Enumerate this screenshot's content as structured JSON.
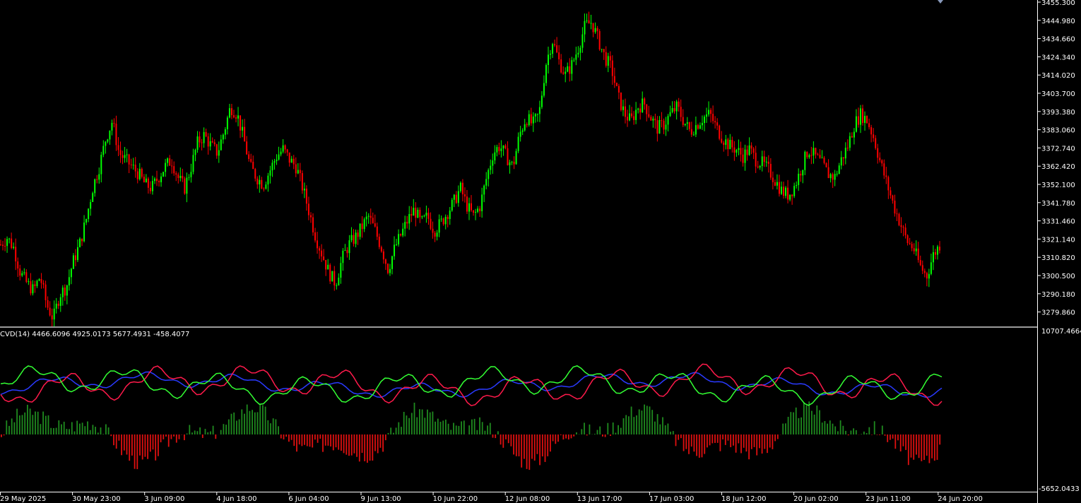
{
  "symbol_chart": {
    "price_axis_labels": [
      "3455.300",
      "3444.980",
      "3434.660",
      "3424.340",
      "3414.020",
      "3403.700",
      "3393.380",
      "3383.060",
      "3372.740",
      "3362.420",
      "3352.100",
      "3341.780",
      "3331.460",
      "3321.140",
      "3310.820",
      "3300.500",
      "3290.180",
      "3279.860"
    ],
    "time_axis_labels": [
      "29 May 2025",
      "30 May 23:00",
      "3 Jun 09:00",
      "4 Jun 18:00",
      "6 Jun 04:00",
      "9 Jun 13:00",
      "10 Jun 22:00",
      "12 Jun 08:00",
      "13 Jun 17:00",
      "17 Jun 03:00",
      "18 Jun 12:00",
      "20 Jun 02:00",
      "23 Jun 11:00",
      "24 Jun 20:00"
    ],
    "colors": {
      "bull": "#00ff00",
      "bear": "#ff0000",
      "background": "#000000",
      "axis": "#ffffff",
      "separator": "#808080"
    }
  },
  "indicator": {
    "title": "CVD(14) 4466.6096 4925.0173 5677.4931 -458.4077",
    "scale_max_label": "10707.4664",
    "scale_min_label": "-5652.0433",
    "colors": {
      "line_red": "#ff1a4b",
      "line_green": "#33ff33",
      "line_blue": "#2a3aff",
      "hist_pos": "#1f8a1f",
      "hist_neg": "#e01010"
    }
  },
  "chart_data": {
    "type": "candlestick",
    "price_range": [
      3274.7,
      3455.3
    ],
    "candles_close_path": [
      3318,
      3322,
      3316,
      3302,
      3296,
      3292,
      3300,
      3284,
      3276,
      3290,
      3294,
      3308,
      3318,
      3332,
      3350,
      3362,
      3378,
      3388,
      3370,
      3366,
      3362,
      3358,
      3352,
      3350,
      3356,
      3362,
      3366,
      3356,
      3350,
      3362,
      3376,
      3380,
      3374,
      3370,
      3382,
      3396,
      3392,
      3378,
      3362,
      3356,
      3352,
      3360,
      3368,
      3372,
      3366,
      3362,
      3350,
      3336,
      3322,
      3312,
      3302,
      3296,
      3310,
      3318,
      3322,
      3328,
      3334,
      3326,
      3316,
      3304,
      3316,
      3324,
      3332,
      3338,
      3330,
      3334,
      3326,
      3330,
      3336,
      3342,
      3350,
      3340,
      3334,
      3340,
      3356,
      3370,
      3374,
      3368,
      3362,
      3380,
      3390,
      3386,
      3392,
      3420,
      3434,
      3422,
      3414,
      3420,
      3430,
      3442,
      3444,
      3434,
      3424,
      3418,
      3402,
      3392,
      3388,
      3396,
      3398,
      3390,
      3384,
      3386,
      3392,
      3396,
      3388,
      3382,
      3386,
      3390,
      3392,
      3384,
      3378,
      3374,
      3372,
      3368,
      3372,
      3366,
      3364,
      3360,
      3354,
      3348,
      3346,
      3352,
      3362,
      3372,
      3368,
      3364,
      3358,
      3356,
      3366,
      3374,
      3386,
      3392,
      3388,
      3378,
      3364,
      3352,
      3340,
      3330,
      3320,
      3316,
      3306,
      3300,
      3312,
      3318
    ],
    "indicator": {
      "name": "CVD(14)",
      "values_shown": [
        4466.6096,
        4925.0173,
        5677.4931,
        -458.4077
      ],
      "scale": [
        -5652.0433,
        10707.4664
      ]
    }
  }
}
